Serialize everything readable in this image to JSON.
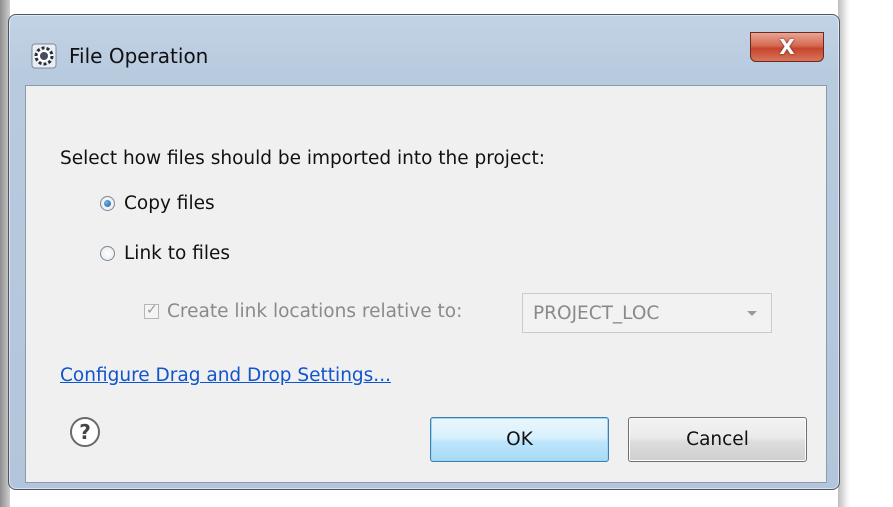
{
  "window": {
    "title": "File Operation",
    "app_icon": "gear-icon",
    "close_label": "X"
  },
  "dialog": {
    "prompt": "Select how files should be imported into the project:",
    "options": [
      {
        "label": "Copy files",
        "selected": true
      },
      {
        "label": "Link to files",
        "selected": false
      }
    ],
    "relative_checkbox": {
      "label": "Create link locations relative to:",
      "checked": true,
      "enabled": false
    },
    "relative_combo": {
      "value": "PROJECT_LOC",
      "enabled": false
    },
    "settings_link": "Configure Drag and Drop Settings...",
    "help_icon": "help-icon",
    "help_glyph": "?",
    "ok_label": "OK",
    "cancel_label": "Cancel"
  },
  "colors": {
    "link": "#1155cc",
    "close_button": "#c6452d",
    "ok_button": "#bee6fd",
    "dialog_background": "#f0f0f0"
  }
}
